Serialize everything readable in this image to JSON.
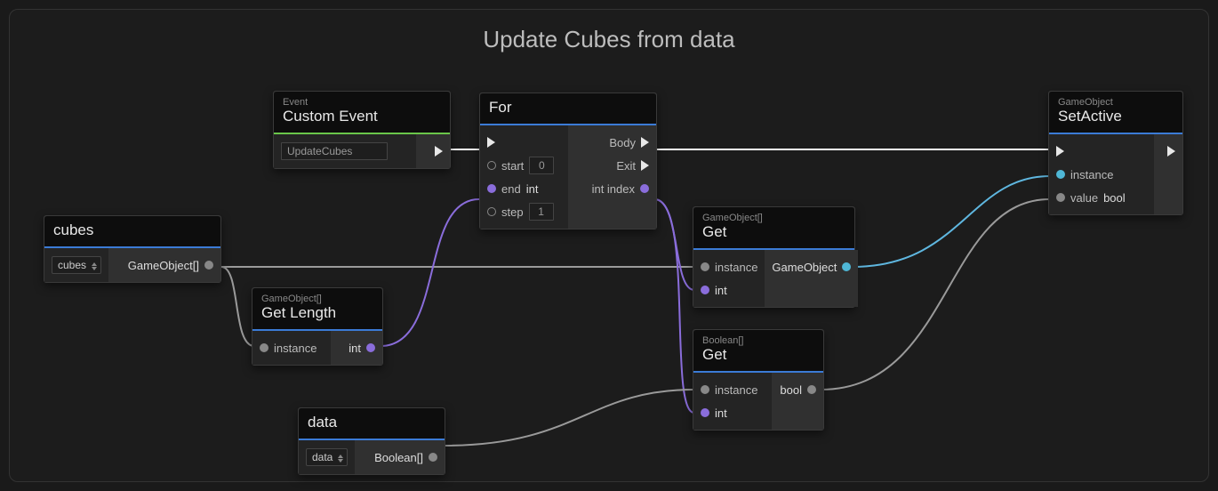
{
  "graph": {
    "title": "Update Cubes from data"
  },
  "nodes": {
    "customEvent": {
      "subtitle": "Event",
      "title": "Custom Event",
      "eventName": "UpdateCubes"
    },
    "for": {
      "title": "For",
      "startLabel": "start",
      "startValue": "0",
      "endLabel": "end",
      "endType": "int",
      "stepLabel": "step",
      "stepValue": "1",
      "bodyLabel": "Body",
      "exitLabel": "Exit",
      "indexLabel": "int index"
    },
    "cubes": {
      "title": "cubes",
      "varName": "cubes",
      "outType": "GameObject[]"
    },
    "getLength": {
      "subtitle": "GameObject[]",
      "title": "Get Length",
      "instanceLabel": "instance",
      "outType": "int"
    },
    "data": {
      "title": "data",
      "varName": "data",
      "outType": "Boolean[]"
    },
    "getGO": {
      "subtitle": "GameObject[]",
      "title": "Get",
      "instanceLabel": "instance",
      "indexType": "int",
      "outType": "GameObject"
    },
    "getBool": {
      "subtitle": "Boolean[]",
      "title": "Get",
      "instanceLabel": "instance",
      "indexType": "int",
      "outType": "bool"
    },
    "setActive": {
      "subtitle": "GameObject",
      "title": "SetActive",
      "instanceLabel": "instance",
      "valueLabel": "value",
      "valueType": "bool"
    }
  }
}
